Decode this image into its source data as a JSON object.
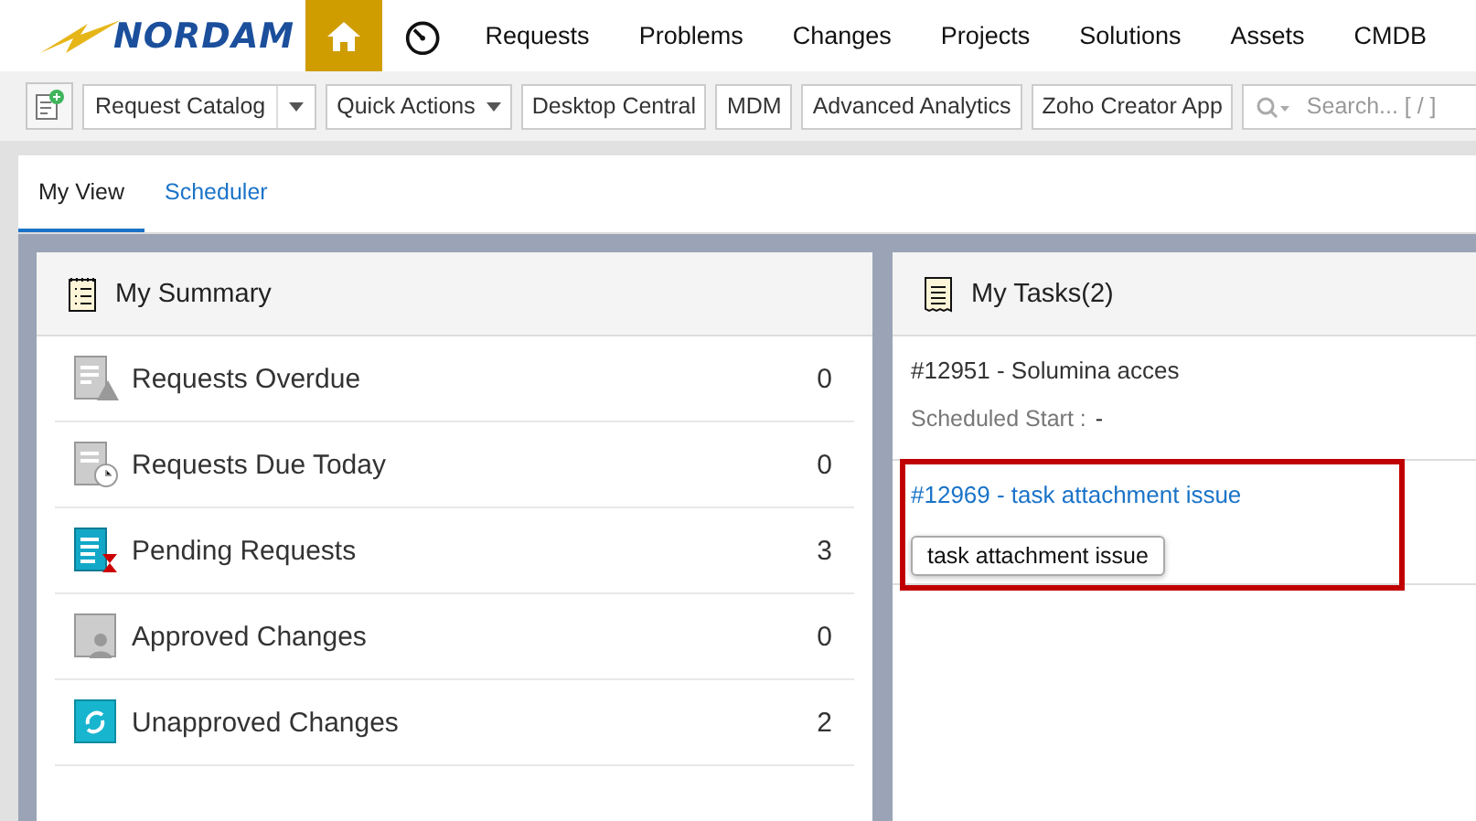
{
  "brand": {
    "logo_text": "NORDAM"
  },
  "nav": [
    {
      "label": "Requests"
    },
    {
      "label": "Problems"
    },
    {
      "label": "Changes"
    },
    {
      "label": "Projects"
    },
    {
      "label": "Solutions"
    },
    {
      "label": "Assets"
    },
    {
      "label": "CMDB"
    }
  ],
  "toolbar": {
    "buttons": [
      {
        "label": "Request Catalog",
        "kind": "split"
      },
      {
        "label": "Quick Actions",
        "kind": "dropdown"
      },
      {
        "label": "Desktop Central",
        "kind": "plain"
      },
      {
        "label": "MDM",
        "kind": "plain"
      },
      {
        "label": "Advanced Analytics",
        "kind": "plain"
      },
      {
        "label": "Zoho Creator App",
        "kind": "plain"
      }
    ],
    "search": {
      "placeholder": "Search... [ / ]"
    }
  },
  "tabs": [
    {
      "label": "My View",
      "selected": true
    },
    {
      "label": "Scheduler",
      "selected": false
    }
  ],
  "summary": {
    "title": "My Summary",
    "items": [
      {
        "label": "Requests Overdue",
        "count": "0",
        "kind": "overdue"
      },
      {
        "label": "Requests Due Today",
        "count": "0",
        "kind": "due"
      },
      {
        "label": "Pending Requests",
        "count": "3",
        "kind": "pending"
      },
      {
        "label": "Approved Changes",
        "count": "0",
        "kind": "approved"
      },
      {
        "label": "Unapproved Changes",
        "count": "2",
        "kind": "unapproved"
      }
    ]
  },
  "tasks": {
    "title": "My Tasks(2)",
    "items": [
      {
        "title": "#12951 - Solumina acces",
        "start_label": "Scheduled Start :",
        "start_value": "-",
        "highlighted": false
      },
      {
        "title": "#12969 - task attachment issue",
        "highlighted": true,
        "tooltip": "task attachment issue"
      }
    ]
  }
}
